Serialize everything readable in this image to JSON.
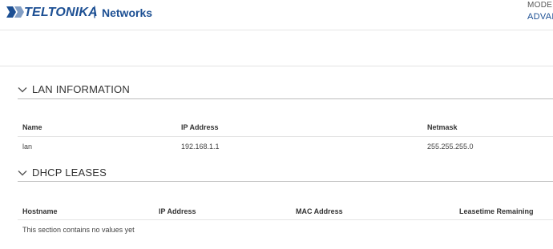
{
  "header": {
    "brand": "TELTONIKA",
    "separator": "|",
    "sub": "Networks",
    "mode_label": "MODE",
    "mode_value": "ADVANCED"
  },
  "lan": {
    "title": "LAN INFORMATION",
    "columns": [
      "Name",
      "IP Address",
      "Netmask"
    ],
    "rows": [
      [
        "lan",
        "192.168.1.1",
        "255.255.255.0"
      ]
    ]
  },
  "dhcp": {
    "title": "DHCP LEASES",
    "columns": [
      "Hostname",
      "IP Address",
      "MAC Address",
      "Leasetime Remaining"
    ],
    "empty_text": "This section contains no values yet"
  },
  "colors": {
    "brand": "#1c4f93",
    "text": "#333333"
  }
}
